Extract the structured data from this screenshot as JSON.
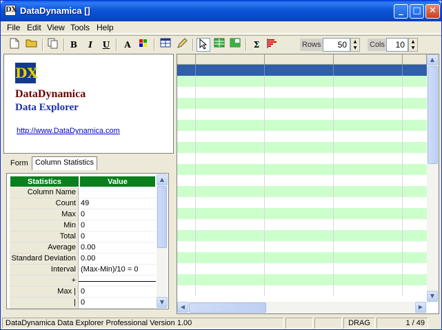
{
  "window": {
    "title": "DataDynamica []",
    "icon_label": "DX"
  },
  "menubar": [
    "File",
    "Edit",
    "View",
    "Tools",
    "Help"
  ],
  "toolbar": {
    "rows_label": "Rows",
    "rows_value": "50",
    "cols_label": "Cols",
    "cols_value": "10",
    "icons": [
      "new-file-icon",
      "open-folder-icon",
      "copy-icon",
      "bold-icon",
      "italic-icon",
      "underline-icon",
      "font-color-icon",
      "palette-icon",
      "table-icon",
      "edit-pen-icon",
      "select-pointer-icon",
      "grid-view-icon",
      "split-view-icon",
      "sum-icon",
      "histogram-icon"
    ]
  },
  "branding": {
    "logo_text": "DX",
    "name": "DataDynamica",
    "product": "Data Explorer",
    "url": "http://www.DataDynamica.com"
  },
  "tabs": {
    "form": "Form",
    "column_statistics": "Column Statistics"
  },
  "stats": {
    "headers": {
      "key": "Statistics",
      "value": "Value"
    },
    "rows": [
      {
        "k": "Column Name",
        "v": ""
      },
      {
        "k": "Count",
        "v": "49"
      },
      {
        "k": "Max",
        "v": "0"
      },
      {
        "k": "Min",
        "v": "0"
      },
      {
        "k": "Total",
        "v": "0"
      },
      {
        "k": "Average",
        "v": "0.00"
      },
      {
        "k": "Standard Deviation",
        "v": "0.00"
      },
      {
        "k": "Interval",
        "v": "(Max-Min)/10 = 0"
      },
      {
        "k": "+",
        "v": ""
      },
      {
        "k": "Max |",
        "v": "0"
      },
      {
        "k": "|",
        "v": "0"
      }
    ]
  },
  "statusbar": {
    "version": "DataDynamica Data Explorer Professional Version 1.00",
    "mode": "DRAG",
    "position": "1 / 49"
  },
  "colors": {
    "accent_green": "#0a7f1e",
    "grid_stripe": "#ccffcc",
    "grid_selected": "#2f5fa8"
  }
}
